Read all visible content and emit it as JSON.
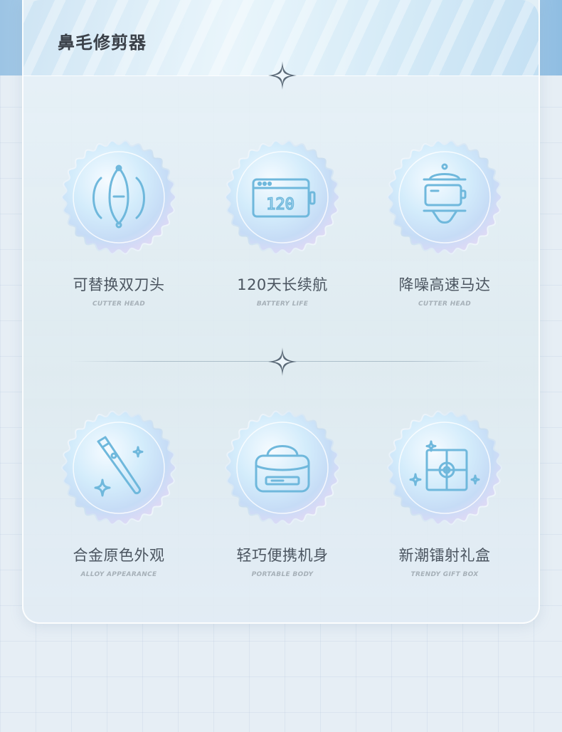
{
  "header": {
    "title": "鼻毛修剪器"
  },
  "features": [
    {
      "title": "可替换双刀头",
      "subtitle": "CUTTER HEAD",
      "icon": "cutter-head-icon"
    },
    {
      "title": "120天长续航",
      "subtitle": "BATTERY LIFE",
      "icon": "battery-icon",
      "icon_text": "120"
    },
    {
      "title": "降噪高速马达",
      "subtitle": "CUTTER HEAD",
      "icon": "motor-icon"
    },
    {
      "title": "合金原色外观",
      "subtitle": "ALLOY APPEARANCE",
      "icon": "alloy-trimmer-icon"
    },
    {
      "title": "轻巧便携机身",
      "subtitle": "PORTABLE BODY",
      "icon": "bag-icon"
    },
    {
      "title": "新潮镭射礼盒",
      "subtitle": "TRENDY GIFT BOX",
      "icon": "gift-box-icon"
    }
  ],
  "colors": {
    "accent": "#6fb8dc",
    "badge_light": "#e8f6fc",
    "badge_edge": "#cfe0f0"
  }
}
